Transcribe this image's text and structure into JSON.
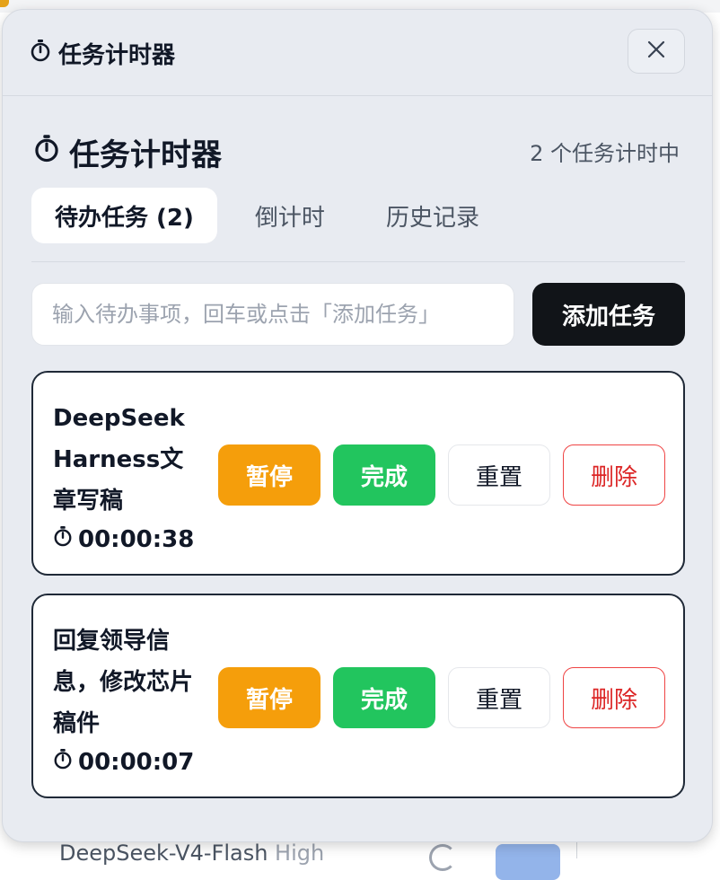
{
  "panel": {
    "header_title": "任务计时器",
    "section_title": "任务计时器",
    "running_count": "2 个任务计时中"
  },
  "tabs": [
    {
      "label": "待办任务 (2)",
      "active": true
    },
    {
      "label": "倒计时",
      "active": false
    },
    {
      "label": "历史记录",
      "active": false
    }
  ],
  "input": {
    "placeholder": "输入待办事项，回车或点击「添加任务」",
    "value": ""
  },
  "add_button": "添加任务",
  "tasks": [
    {
      "name": "DeepSeek Harness文章写稿",
      "elapsed": "00:00:38",
      "pause_label": "暂停",
      "done_label": "完成",
      "reset_label": "重置",
      "delete_label": "删除"
    },
    {
      "name": "回复领导信息，修改芯片稿件",
      "elapsed": "00:00:07",
      "pause_label": "暂停",
      "done_label": "完成",
      "reset_label": "重置",
      "delete_label": "删除"
    }
  ],
  "background": {
    "bottom_model": "DeepSeek-V4-Flash",
    "bottom_mode": "High"
  },
  "colors": {
    "panel_bg": "#e8ebf1",
    "pause": "#f59e0b",
    "done": "#22c55e",
    "delete": "#dc2626",
    "primary_button": "#111418"
  },
  "icons": {
    "timer": "stopwatch-icon",
    "close": "close-icon"
  }
}
